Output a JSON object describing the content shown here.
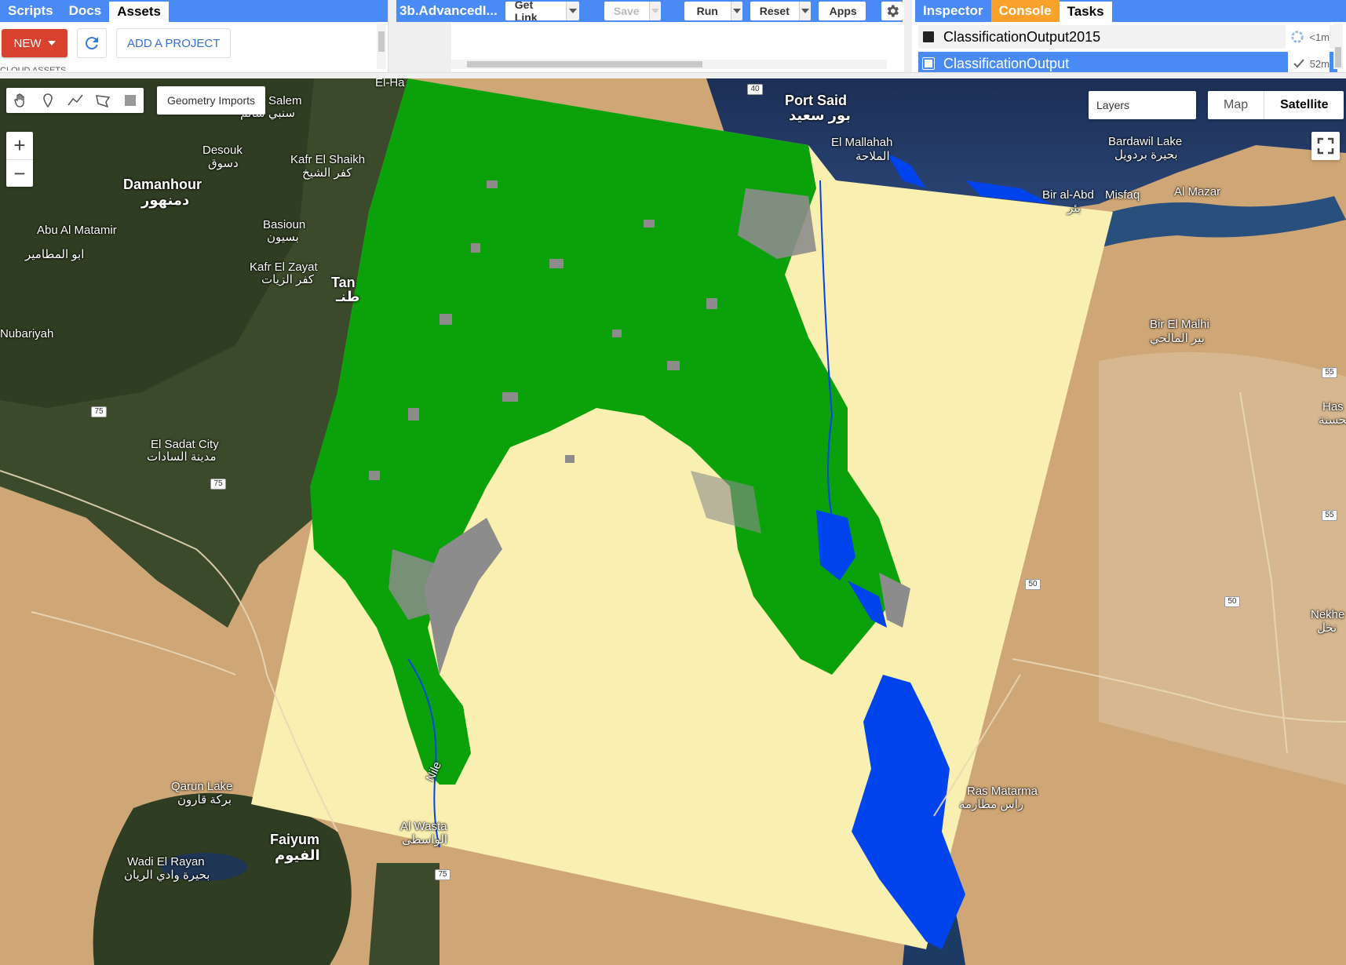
{
  "left_panel": {
    "tabs": [
      {
        "label": "Scripts"
      },
      {
        "label": "Docs"
      },
      {
        "label": "Assets"
      }
    ],
    "new_button": "NEW",
    "add_project_button": "ADD A PROJECT",
    "section_cut_label": "CLOUD ASSETS"
  },
  "code_panel": {
    "file_title": "3b.AdvancedI...",
    "get_link": "Get Link",
    "save": "Save",
    "run": "Run",
    "reset": "Reset",
    "apps": "Apps"
  },
  "right_panel": {
    "tabs": [
      {
        "label": "Inspector"
      },
      {
        "label": "Console"
      },
      {
        "label": "Tasks"
      }
    ],
    "tasks": [
      {
        "name": "ClassificationOutput2015",
        "status": "<1m",
        "icon": "spinner-icon"
      },
      {
        "name": "ClassificationOutput",
        "status": "52m",
        "icon": "check-icon"
      }
    ]
  },
  "map": {
    "geometry_imports": "Geometry Imports",
    "layers": "Layers",
    "map_type": {
      "map": "Map",
      "satellite": "Satellite"
    },
    "zoom_in": "+",
    "zoom_out": "−",
    "labels": [
      {
        "name": "Port Said",
        "ar": "بور سعيد"
      },
      {
        "name": "El Mallahah",
        "ar": "الملاحة"
      },
      {
        "name": "Bardawil Lake",
        "ar": "بحيرة بردويل"
      },
      {
        "name": "Bir al-Abd",
        "ar": "بئر"
      },
      {
        "name": "Misfaq"
      },
      {
        "name": "Al Mazar"
      },
      {
        "name": "Bir El Malhi",
        "ar": "بير المالحي"
      },
      {
        "name": "Salem",
        "ar": "سنبي سالم"
      },
      {
        "name": "Desouk",
        "ar": "دسوق"
      },
      {
        "name": "Kafr El Shaikh",
        "ar": "كفر الشيخ"
      },
      {
        "name": "Damanhour",
        "ar": "دمنهور"
      },
      {
        "name": "Basioun",
        "ar": "بسيون"
      },
      {
        "name": "Abu Al Matamir",
        "ar": "ابو المطامير"
      },
      {
        "name": "Kafr El Zayat",
        "ar": "كفر الزيات"
      },
      {
        "name": "Tan",
        "ar": "طنـ"
      },
      {
        "name": "Nubariyah"
      },
      {
        "name": "El Sadat City",
        "ar": "مدينة السادات"
      },
      {
        "name": "El-Ha"
      },
      {
        "name": "Qarun Lake",
        "ar": "بركة قارون"
      },
      {
        "name": "Faiyum",
        "ar": "الفيوم"
      },
      {
        "name": "Wadi El Rayan",
        "ar": "بحيرة وادي الريان"
      },
      {
        "name": "Al Wasta",
        "ar": "الواسطى"
      },
      {
        "name": "Ras Matarma",
        "ar": "راس مطارمة"
      },
      {
        "name": "Nekhe",
        "ar": "نخل"
      },
      {
        "name": "Has",
        "ar": "الحسنة"
      },
      {
        "name": "Nile"
      }
    ],
    "road_shields": [
      "40",
      "75",
      "75",
      "75",
      "55",
      "55",
      "50",
      "50"
    ],
    "colors": {
      "vegetation": "#0aa10a",
      "urban": "#8c8c8c",
      "water": "#0044ee",
      "desert": "#f9efb0"
    }
  }
}
